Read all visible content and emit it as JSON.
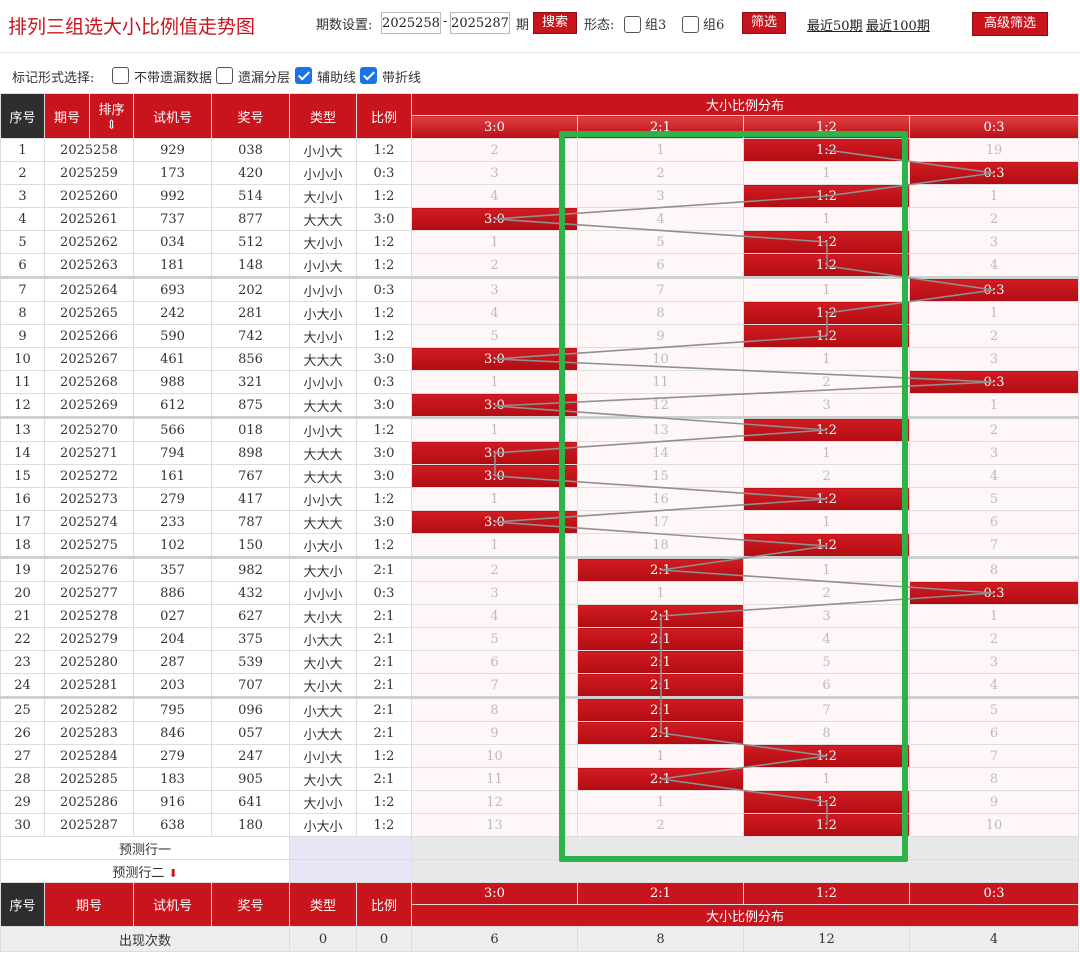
{
  "title": "排列三组选大小比例值走势图",
  "toolbar": {
    "period_label": "期数设置:",
    "from": "2025258",
    "dash": "-",
    "to": "2025287",
    "period_suffix": "期",
    "search": "搜索",
    "form_label": "形态:",
    "g3": "组3",
    "g6": "组6",
    "filter": "筛选",
    "last50": "最近50期",
    "last100": "最近100期",
    "advanced": "高级筛选"
  },
  "mark": {
    "label": "标记形式选择:",
    "opt1": "不带遗漏数据",
    "opt2": "遗漏分层",
    "opt3": "辅助线",
    "opt4": "带折线"
  },
  "headers": {
    "seq": "序号",
    "period": "期号",
    "sort": "排序",
    "test": "试机号",
    "prize": "奖号",
    "type": "类型",
    "ratio": "比例",
    "dist": "大小比例分布",
    "cols": [
      "3:0",
      "2:1",
      "1:2",
      "0:3"
    ]
  },
  "rows": [
    {
      "seq": "1",
      "period": "2025258",
      "test": "929",
      "prize": "038",
      "type": "小小大",
      "ratio": "1:2",
      "cells": [
        "2",
        "1",
        "1:2",
        "19"
      ],
      "hit": 2
    },
    {
      "seq": "2",
      "period": "2025259",
      "test": "173",
      "prize": "420",
      "type": "小小小",
      "ratio": "0:3",
      "cells": [
        "3",
        "2",
        "1",
        "0:3"
      ],
      "hit": 3
    },
    {
      "seq": "3",
      "period": "2025260",
      "test": "992",
      "prize": "514",
      "type": "大小小",
      "ratio": "1:2",
      "cells": [
        "4",
        "3",
        "1:2",
        "1"
      ],
      "hit": 2
    },
    {
      "seq": "4",
      "period": "2025261",
      "test": "737",
      "prize": "877",
      "type": "大大大",
      "ratio": "3:0",
      "cells": [
        "3:0",
        "4",
        "1",
        "2"
      ],
      "hit": 0
    },
    {
      "seq": "5",
      "period": "2025262",
      "test": "034",
      "prize": "512",
      "type": "大小小",
      "ratio": "1:2",
      "cells": [
        "1",
        "5",
        "1:2",
        "3"
      ],
      "hit": 2
    },
    {
      "seq": "6",
      "period": "2025263",
      "test": "181",
      "prize": "148",
      "type": "小小大",
      "ratio": "1:2",
      "cells": [
        "2",
        "6",
        "1:2",
        "4"
      ],
      "hit": 2
    },
    {
      "seq": "7",
      "period": "2025264",
      "test": "693",
      "prize": "202",
      "type": "小小小",
      "ratio": "0:3",
      "cells": [
        "3",
        "7",
        "1",
        "0:3"
      ],
      "hit": 3
    },
    {
      "seq": "8",
      "period": "2025265",
      "test": "242",
      "prize": "281",
      "type": "小大小",
      "ratio": "1:2",
      "cells": [
        "4",
        "8",
        "1:2",
        "1"
      ],
      "hit": 2
    },
    {
      "seq": "9",
      "period": "2025266",
      "test": "590",
      "prize": "742",
      "type": "大小小",
      "ratio": "1:2",
      "cells": [
        "5",
        "9",
        "1:2",
        "2"
      ],
      "hit": 2
    },
    {
      "seq": "10",
      "period": "2025267",
      "test": "461",
      "prize": "856",
      "type": "大大大",
      "ratio": "3:0",
      "cells": [
        "3:0",
        "10",
        "1",
        "3"
      ],
      "hit": 0
    },
    {
      "seq": "11",
      "period": "2025268",
      "test": "988",
      "prize": "321",
      "type": "小小小",
      "ratio": "0:3",
      "cells": [
        "1",
        "11",
        "2",
        "0:3"
      ],
      "hit": 3
    },
    {
      "seq": "12",
      "period": "2025269",
      "test": "612",
      "prize": "875",
      "type": "大大大",
      "ratio": "3:0",
      "cells": [
        "3:0",
        "12",
        "3",
        "1"
      ],
      "hit": 0
    },
    {
      "seq": "13",
      "period": "2025270",
      "test": "566",
      "prize": "018",
      "type": "小小大",
      "ratio": "1:2",
      "cells": [
        "1",
        "13",
        "1:2",
        "2"
      ],
      "hit": 2
    },
    {
      "seq": "14",
      "period": "2025271",
      "test": "794",
      "prize": "898",
      "type": "大大大",
      "ratio": "3:0",
      "cells": [
        "3:0",
        "14",
        "1",
        "3"
      ],
      "hit": 0
    },
    {
      "seq": "15",
      "period": "2025272",
      "test": "161",
      "prize": "767",
      "type": "大大大",
      "ratio": "3:0",
      "cells": [
        "3:0",
        "15",
        "2",
        "4"
      ],
      "hit": 0
    },
    {
      "seq": "16",
      "period": "2025273",
      "test": "279",
      "prize": "417",
      "type": "小小大",
      "ratio": "1:2",
      "cells": [
        "1",
        "16",
        "1:2",
        "5"
      ],
      "hit": 2
    },
    {
      "seq": "17",
      "period": "2025274",
      "test": "233",
      "prize": "787",
      "type": "大大大",
      "ratio": "3:0",
      "cells": [
        "3:0",
        "17",
        "1",
        "6"
      ],
      "hit": 0
    },
    {
      "seq": "18",
      "period": "2025275",
      "test": "102",
      "prize": "150",
      "type": "小大小",
      "ratio": "1:2",
      "cells": [
        "1",
        "18",
        "1:2",
        "7"
      ],
      "hit": 2
    },
    {
      "seq": "19",
      "period": "2025276",
      "test": "357",
      "prize": "982",
      "type": "大大小",
      "ratio": "2:1",
      "cells": [
        "2",
        "2:1",
        "1",
        "8"
      ],
      "hit": 1
    },
    {
      "seq": "20",
      "period": "2025277",
      "test": "886",
      "prize": "432",
      "type": "小小小",
      "ratio": "0:3",
      "cells": [
        "3",
        "1",
        "2",
        "0:3"
      ],
      "hit": 3
    },
    {
      "seq": "21",
      "period": "2025278",
      "test": "027",
      "prize": "627",
      "type": "大小大",
      "ratio": "2:1",
      "cells": [
        "4",
        "2:1",
        "3",
        "1"
      ],
      "hit": 1
    },
    {
      "seq": "22",
      "period": "2025279",
      "test": "204",
      "prize": "375",
      "type": "小大大",
      "ratio": "2:1",
      "cells": [
        "5",
        "2:1",
        "4",
        "2"
      ],
      "hit": 1
    },
    {
      "seq": "23",
      "period": "2025280",
      "test": "287",
      "prize": "539",
      "type": "大小大",
      "ratio": "2:1",
      "cells": [
        "6",
        "2:1",
        "5",
        "3"
      ],
      "hit": 1
    },
    {
      "seq": "24",
      "period": "2025281",
      "test": "203",
      "prize": "707",
      "type": "大小大",
      "ratio": "2:1",
      "cells": [
        "7",
        "2:1",
        "6",
        "4"
      ],
      "hit": 1
    },
    {
      "seq": "25",
      "period": "2025282",
      "test": "795",
      "prize": "096",
      "type": "小大大",
      "ratio": "2:1",
      "cells": [
        "8",
        "2:1",
        "7",
        "5"
      ],
      "hit": 1
    },
    {
      "seq": "26",
      "period": "2025283",
      "test": "846",
      "prize": "057",
      "type": "小大大",
      "ratio": "2:1",
      "cells": [
        "9",
        "2:1",
        "8",
        "6"
      ],
      "hit": 1
    },
    {
      "seq": "27",
      "period": "2025284",
      "test": "279",
      "prize": "247",
      "type": "小小大",
      "ratio": "1:2",
      "cells": [
        "10",
        "1",
        "1:2",
        "7"
      ],
      "hit": 2
    },
    {
      "seq": "28",
      "period": "2025285",
      "test": "183",
      "prize": "905",
      "type": "大小大",
      "ratio": "2:1",
      "cells": [
        "11",
        "2:1",
        "1",
        "8"
      ],
      "hit": 1
    },
    {
      "seq": "29",
      "period": "2025286",
      "test": "916",
      "prize": "641",
      "type": "大小小",
      "ratio": "1:2",
      "cells": [
        "12",
        "1",
        "1:2",
        "9"
      ],
      "hit": 2
    },
    {
      "seq": "30",
      "period": "2025287",
      "test": "638",
      "prize": "180",
      "type": "小大小",
      "ratio": "1:2",
      "cells": [
        "13",
        "2",
        "1:2",
        "10"
      ],
      "hit": 2
    }
  ],
  "predict": {
    "row1": "预测行一",
    "row2": "预测行二"
  },
  "stats": {
    "label": "出现次数",
    "type": "0",
    "ratio": "0",
    "counts": [
      "6",
      "8",
      "12",
      "4"
    ]
  },
  "colors": {
    "brand": "#c8141c",
    "highlight": "#2fb24a",
    "line": "#909090"
  }
}
